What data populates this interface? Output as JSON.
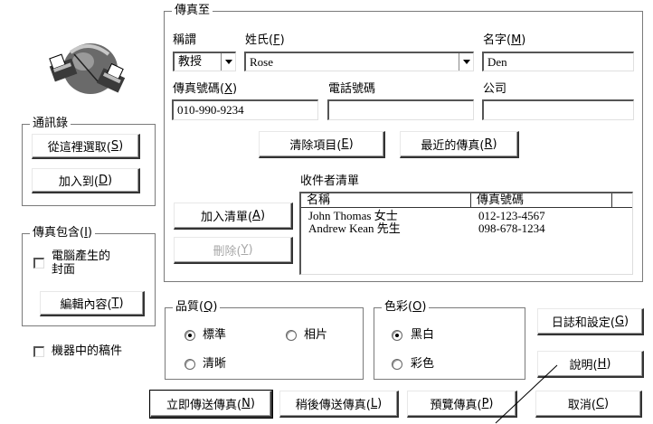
{
  "fax_to": {
    "group_label": "傳真至",
    "title_label": "稱謂",
    "title_value": "教授",
    "last_name_label": "姓氏(F)",
    "last_name_value": "Rose",
    "first_name_label": "名字(M)",
    "first_name_value": "Den",
    "fax_number_label": "傳真號碼(X)",
    "fax_number_value": "010-990-9234",
    "phone_label": "電話號碼",
    "phone_value": "",
    "company_label": "公司",
    "company_value": "",
    "clear_button": "清除項目(E)",
    "recent_button": "最近的傳真(R)"
  },
  "address_book": {
    "group_label": "通訊錄",
    "select_button": "從這裡選取(S)",
    "add_to_button": "加入到(D)"
  },
  "recipients": {
    "label": "收件者清單",
    "add_button": "加入清單(A)",
    "delete_button": "刪除(Y)",
    "columns": [
      "名稱",
      "傳真號碼"
    ],
    "rows": [
      {
        "name": "John Thomas 女士",
        "fax": "012-123-4567"
      },
      {
        "name": "Andrew Kean 先生",
        "fax": "098-678-1234"
      }
    ]
  },
  "fax_includes": {
    "group_label": "傳真包含(I)",
    "cover_checkbox": "電腦產生的封面",
    "cover_line1": "電腦產生的",
    "cover_line2": "封面",
    "cover_checked": false,
    "edit_button": "編輯內容(T)"
  },
  "machine_docs": {
    "label": "機器中的稿件",
    "checked": false
  },
  "quality": {
    "group_label": "品質(Q)",
    "options": [
      "標準",
      "相片",
      "清晰"
    ],
    "selected": "標準"
  },
  "color": {
    "group_label": "色彩(O)",
    "options": [
      "黑白",
      "彩色"
    ],
    "selected": "黑白"
  },
  "buttons": {
    "log_settings": "日誌和設定(G)",
    "help": "說明(H)",
    "send_now": "立即傳送傳真(N)",
    "send_later": "稍後傳送傳真(L)",
    "preview": "預覽傳真(P)",
    "cancel": "取消(C)"
  },
  "icons": {
    "fax_logo": "fax-globe-icon",
    "dropdown": "chevron-down-icon"
  }
}
